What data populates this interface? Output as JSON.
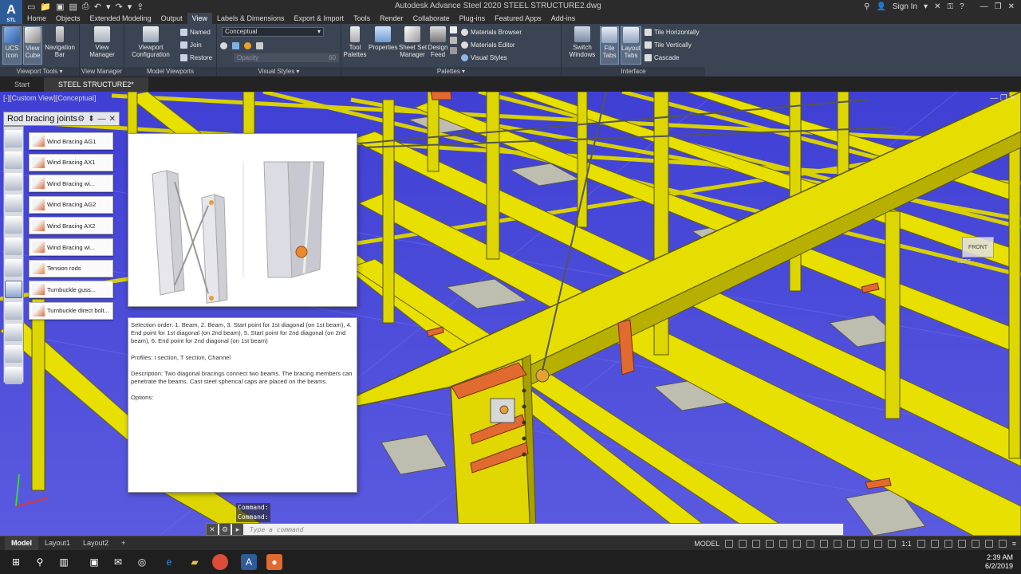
{
  "titlebar": {
    "app_logo": "A",
    "app_logo_sub": "STL",
    "title": "Autodesk Advance Steel 2020   STEEL STRUCTURE2.dwg",
    "sign_in": "Sign In"
  },
  "menu_tabs": [
    "Home",
    "Objects",
    "Extended Modeling",
    "Output",
    "View",
    "Labels & Dimensions",
    "Export & Import",
    "Tools",
    "Render",
    "Collaborate",
    "Plug-ins",
    "Featured Apps",
    "Add-ins"
  ],
  "active_menu_tab": "View",
  "ribbon": {
    "ucs_icon": "UCS\nIcon",
    "view_cube": "View\nCube",
    "navigation_bar": "Navigation\nBar",
    "view_manager": "View\nManager",
    "viewport_config": "Viewport\nConfiguration",
    "named": "Named",
    "join": "Join",
    "restore": "Restore",
    "visual_style": "Conceptual",
    "opacity_label": "Opacity",
    "opacity_value": "60",
    "tool_palettes": "Tool\nPalettes",
    "properties": "Properties",
    "sheet_set_manager": "Sheet Set\nManager",
    "design_feed": "Design\nFeed",
    "materials_browser": "Materials Browser",
    "materials_editor": "Materials Editor",
    "visual_styles_btn": "Visual Styles",
    "switch_windows": "Switch\nWindows",
    "file_tabs": "File\nTabs",
    "layout_tabs": "Layout\nTabs",
    "tile_horizontally": "Tile Horizontally",
    "tile_vertically": "Tile Vertically",
    "cascade": "Cascade",
    "panel_titles": {
      "viewport_tools": "Viewport Tools",
      "view_manager": "View Manager",
      "model_viewports": "Model Viewports",
      "visual_styles": "Visual Styles",
      "palettes": "Palettes",
      "interface": "Interface"
    }
  },
  "file_tabs": [
    "Start",
    "STEEL STRUCTURE2*"
  ],
  "viewport": {
    "label": "[-][Custom View][Conceptual]",
    "viewcube_face": "FRONT",
    "viewcube_side": "LEFT"
  },
  "palette": {
    "title": "Rod bracing joints",
    "items": [
      "Wind Bracing AG1",
      "Wind Bracing AX1",
      "Wind Bracing wi...",
      "Wind Bracing AG2",
      "Wind Bracing AX2",
      "Wind Bracing wi...",
      "Tension rods",
      "Turnbuckle guss...",
      "Turnbuckle direct bolt..."
    ]
  },
  "description": {
    "selection_order": "Selection order: 1. Beam, 2. Beam, 3. Start point for 1st diagonal (on 1st beam), 4. End point for 1st diagonal (on 2nd beam), 5. Start point for 2nd diagonal (on 2nd beam), 6. End point for 2nd diagonal (on 1st beam)",
    "profiles": "Profiles: I section, T section, Channel",
    "description": "Description: Two diagonal bracings connect two beams. The bracing members can penetrate the beams. Cast steel spherical caps are placed on the beams.",
    "options": "Options:"
  },
  "command": {
    "history": [
      "Command:",
      "Command:"
    ],
    "placeholder": "Type a command"
  },
  "status": {
    "layout_tabs": [
      "Model",
      "Layout1",
      "Layout2",
      "+"
    ],
    "model_label": "MODEL",
    "scale": "1:1"
  },
  "taskbar": {
    "time": "2:39 AM",
    "date": "6/2/2019"
  },
  "colors": {
    "steel_yellow": "#e8e000",
    "viewport_blue": "#4a4ad8",
    "plate_orange": "#e06a30",
    "ribbon_bg": "#3b4453"
  }
}
